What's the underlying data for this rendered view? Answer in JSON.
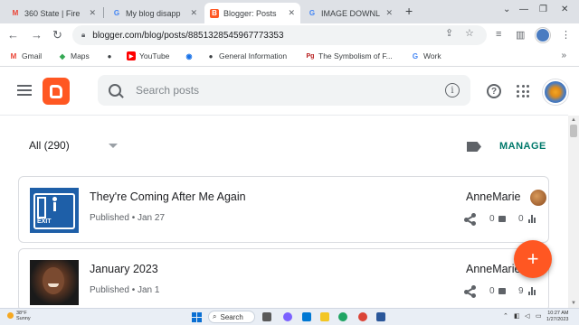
{
  "browser": {
    "tabs": [
      {
        "favicon": "gmail-icon",
        "title": "360 State | Fire"
      },
      {
        "favicon": "google-icon",
        "title": "My blog disapp"
      },
      {
        "favicon": "blogger-icon",
        "title": "Blogger: Posts",
        "active": true
      },
      {
        "favicon": "google-icon",
        "title": "IMAGE DOWNL"
      }
    ],
    "url": "blogger.com/blog/posts/8851328545967773353",
    "bookmarks": [
      {
        "icon": "gmail-icon",
        "label": "Gmail"
      },
      {
        "icon": "maps-icon",
        "label": "Maps"
      },
      {
        "icon": "globe-icon",
        "label": ""
      },
      {
        "icon": "youtube-icon",
        "label": "YouTube"
      },
      {
        "icon": "bookmark-icon",
        "label": ""
      },
      {
        "icon": "globe-icon",
        "label": "General Information"
      },
      {
        "icon": "pg-icon",
        "label": "The Symbolism of F..."
      },
      {
        "icon": "google-icon",
        "label": "Work"
      }
    ]
  },
  "app": {
    "search_placeholder": "Search posts",
    "filter_label": "All (290)",
    "manage_label": "MANAGE"
  },
  "posts": [
    {
      "title": "They're Coming After Me Again",
      "meta": "Published • Jan 27",
      "author": "AnneMarie",
      "comments": "0",
      "views": "0"
    },
    {
      "title": "January 2023",
      "meta": "Published • Jan 1",
      "author": "AnneMarie",
      "comments": "0",
      "views": "9"
    }
  ],
  "taskbar": {
    "weather_temp": "38°F",
    "weather_desc": "Sunny",
    "search_label": "Search",
    "time": "10:27 AM",
    "date": "1/27/2023"
  },
  "colors": {
    "accent": "#ff5722",
    "manage": "#00796b"
  }
}
